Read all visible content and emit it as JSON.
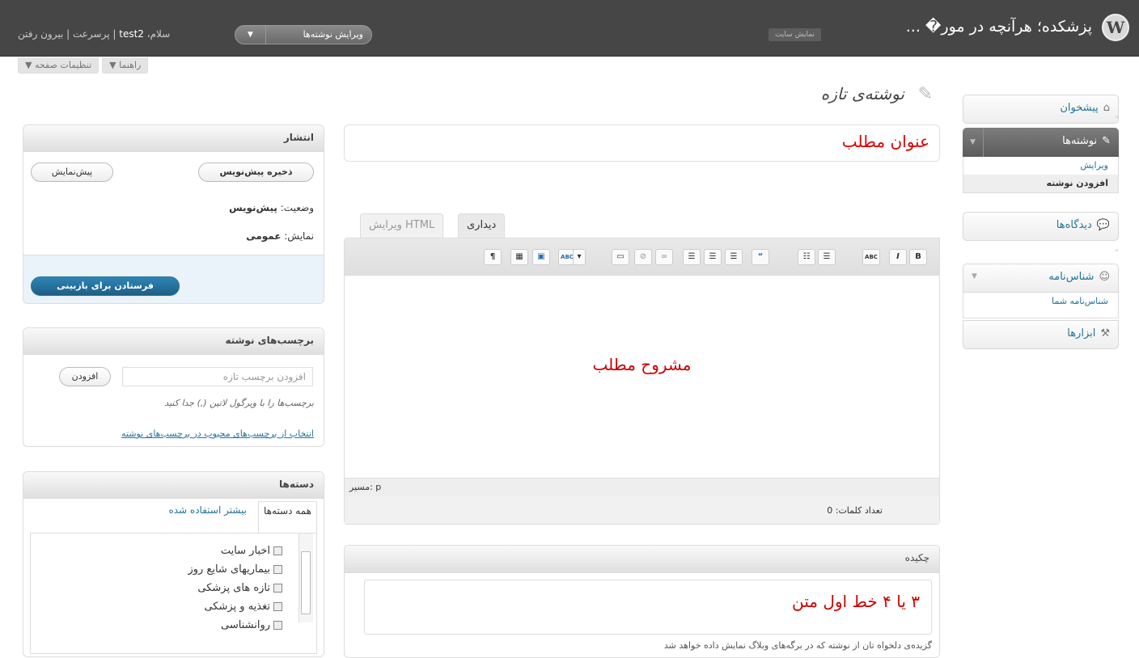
{
  "header": {
    "logo": "W",
    "site_title": "پزشکده؛ هرآنچه در مور� ...",
    "view_site": "نمایش سایت",
    "favorite": "ویرایش نوشته‌ها",
    "favorite_arrow": "▼",
    "greeting": "سلام،",
    "username": "test2",
    "help_link": "پرسرعت",
    "logout": "بیرون رفتن"
  },
  "screen_tabs": {
    "options": "▼ تنظیمات صفحه",
    "help": "▼ راهنما"
  },
  "page": {
    "title": "نوشته‌ی تازه",
    "pin_icon": "✎"
  },
  "menu": {
    "dashboard": "پیشخوان",
    "posts": "نوشته‌ها",
    "posts_sub": [
      "ویرایش",
      "افزودن نوشته"
    ],
    "comments": "دیدگاه‌ها",
    "profile": "شناس‌نامه",
    "profile_sub": "شناس‌نامه شما",
    "tools": "ابزارها"
  },
  "editor": {
    "title_value": "عنوان مطلب",
    "tab_visual": "دیداری",
    "tab_html": "ویرایش HTML",
    "content": "مشروح مطلب",
    "path": "مسیر: p",
    "word_count": "تعداد کلمات: 0",
    "toolbar": [
      "B",
      "I",
      "ABC",
      "☰",
      "☷",
      "“",
      "☰",
      "☰",
      "☰",
      "∞",
      "⊘",
      "▭",
      "ABC",
      "▾",
      "▣",
      "▦",
      "¶"
    ]
  },
  "excerpt": {
    "title": "چکیده",
    "value": "۳ یا ۴ خط اول متن",
    "note": "گزیده‌ی دلخواه تان از نوشته که در برگه‌های وبلاگ نمایش داده خواهد شد"
  },
  "publish": {
    "title": "انتشار",
    "save_draft": "ذخیره پیش‌نویس",
    "preview": "پیش‌نمایش",
    "status_label": "وضعیت:",
    "status_value": "پیش‌نویس",
    "visibility_label": "نمایش:",
    "visibility_value": "عمومی",
    "submit": "فرستادن برای بازبینی"
  },
  "tags": {
    "title": "برچسب‌های نوشته",
    "placeholder": "افزودن برچسب تازه",
    "add": "افزودن",
    "hint": "برچسب‌ها را با ویرگول لاتین (,) جدا کنید",
    "choose": "انتخاب از برچسب‌های محبوب در برچسب‌های نوشته"
  },
  "categories": {
    "title": "دسته‌ها",
    "tab_all": "همه دسته‌ها",
    "tab_popular": "بیشتر استفاده شده",
    "items": [
      "اخبار سایت",
      "بیماریهای شایع روز",
      "تازه های پزشکی",
      "تغذیه و پزشکی",
      "روانشناسی"
    ]
  }
}
